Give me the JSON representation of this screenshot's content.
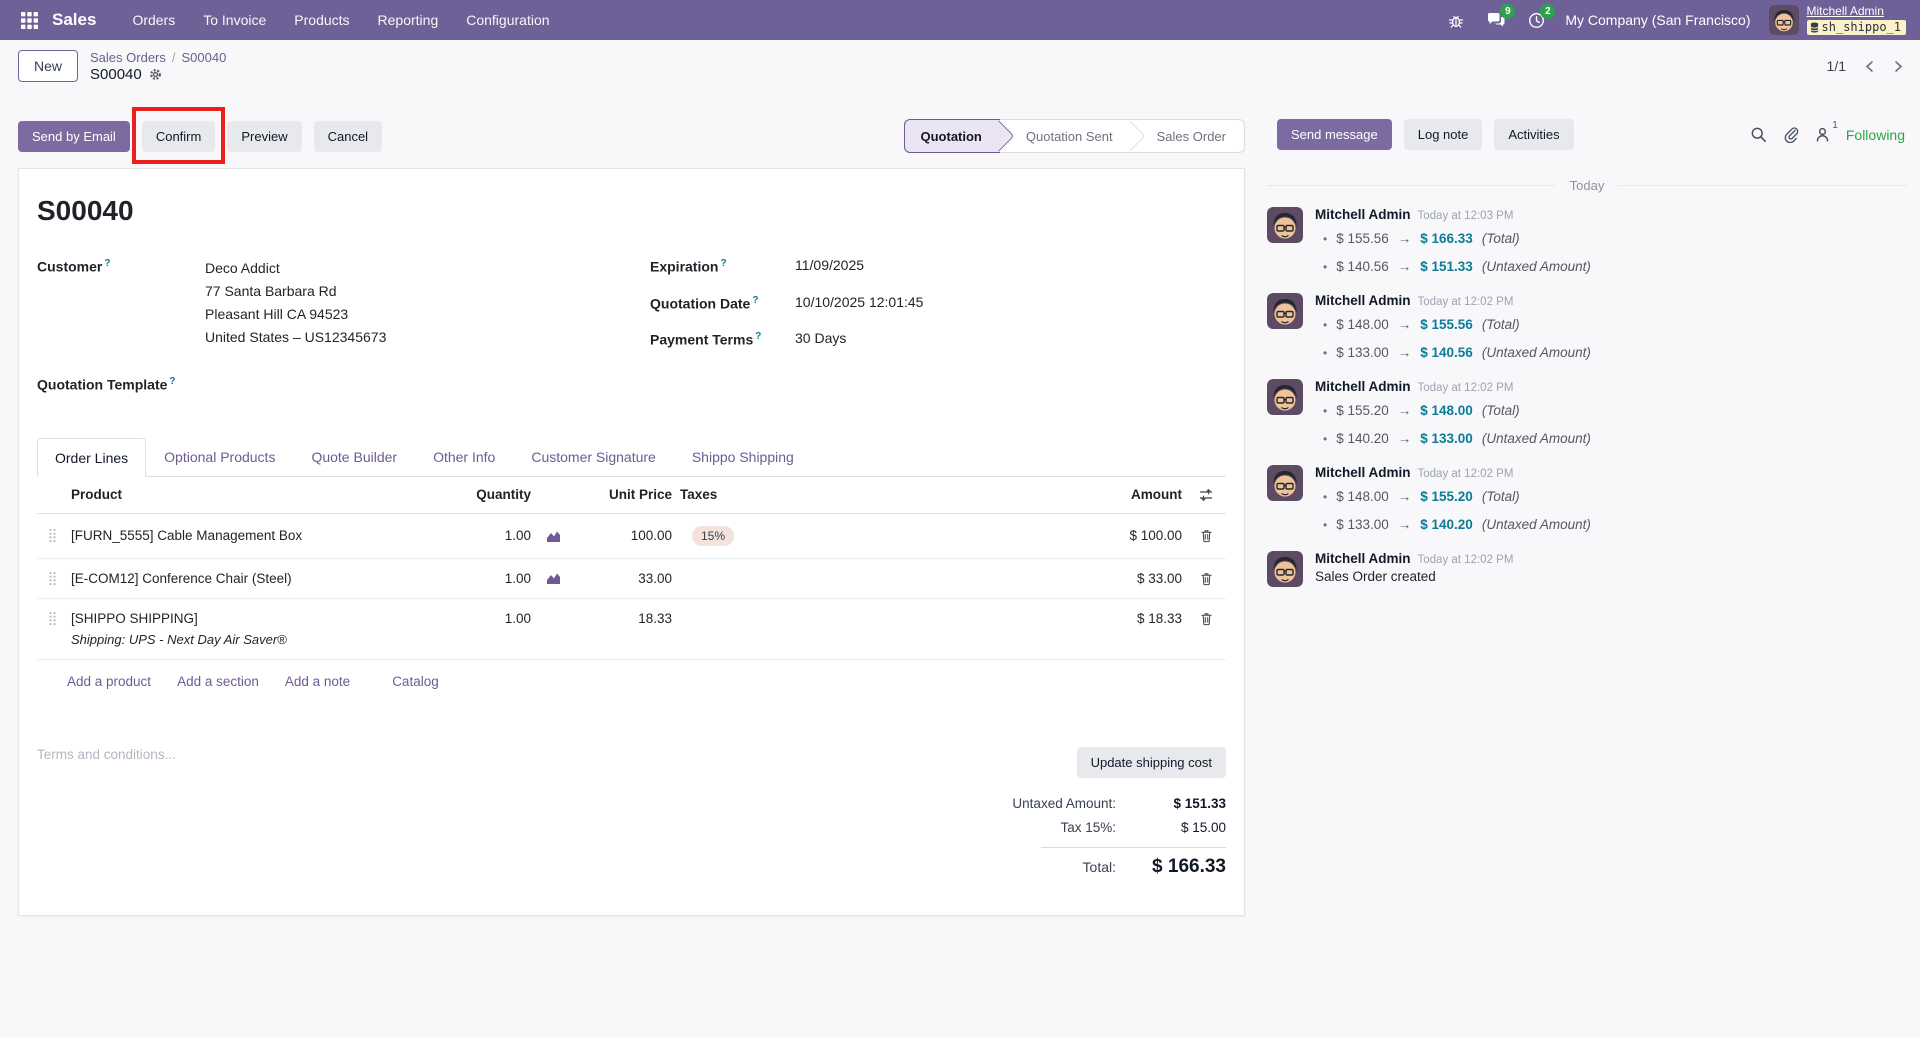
{
  "topbar": {
    "app_name": "Sales",
    "menus": [
      "Orders",
      "To Invoice",
      "Products",
      "Reporting",
      "Configuration"
    ],
    "messages_badge": "9",
    "activities_badge": "2",
    "company": "My Company (San Francisco)",
    "user_name": "Mitchell Admin",
    "database": "sh_shippo_1"
  },
  "control_panel": {
    "new_button": "New",
    "breadcrumb_parent": "Sales Orders",
    "breadcrumb_sep": "/",
    "breadcrumb_current": "S00040",
    "record_name": "S00040",
    "pager": "1/1"
  },
  "actions": {
    "send_by_email": "Send by Email",
    "confirm": "Confirm",
    "preview": "Preview",
    "cancel": "Cancel"
  },
  "statusbar": {
    "steps": [
      "Quotation",
      "Quotation Sent",
      "Sales Order"
    ]
  },
  "form": {
    "title": "S00040",
    "help_marker": "?",
    "customer_label": "Customer",
    "customer_name": "Deco Addict",
    "address_line1": "77 Santa Barbara Rd",
    "address_line2": "Pleasant Hill CA 94523",
    "address_line3": "United States – US12345673",
    "quotation_template_label": "Quotation Template",
    "expiration_label": "Expiration",
    "expiration": "11/09/2025",
    "quotation_date_label": "Quotation Date",
    "quotation_date": "10/10/2025 12:01:45",
    "payment_terms_label": "Payment Terms",
    "payment_terms": "30 Days",
    "tabs": [
      "Order Lines",
      "Optional Products",
      "Quote Builder",
      "Other Info",
      "Customer Signature",
      "Shippo Shipping"
    ],
    "table": {
      "headers": {
        "product": "Product",
        "quantity": "Quantity",
        "unit_price": "Unit Price",
        "taxes": "Taxes",
        "amount": "Amount"
      },
      "rows": [
        {
          "product": "[FURN_5555] Cable Management Box",
          "quantity": "1.00",
          "unit_price": "100.00",
          "tax": "15%",
          "amount": "$ 100.00"
        },
        {
          "product": "[E-COM12] Conference Chair (Steel)",
          "quantity": "1.00",
          "unit_price": "33.00",
          "tax": "",
          "amount": "$ 33.00"
        },
        {
          "product": "[SHIPPO SHIPPING]",
          "note": "Shipping: UPS - Next Day Air Saver®",
          "quantity": "1.00",
          "unit_price": "18.33",
          "tax": "",
          "amount": "$ 18.33"
        }
      ],
      "links": {
        "add_product": "Add a product",
        "add_section": "Add a section",
        "add_note": "Add a note",
        "catalog": "Catalog"
      }
    },
    "terms_placeholder": "Terms and conditions...",
    "update_shipping": "Update shipping cost",
    "totals": {
      "untaxed_label": "Untaxed Amount:",
      "untaxed_value": "$ 151.33",
      "tax_label": "Tax 15%:",
      "tax_value": "$ 15.00",
      "total_label": "Total:",
      "total_value": "$ 166.33"
    }
  },
  "chatter": {
    "send_message": "Send message",
    "log_note": "Log note",
    "activities": "Activities",
    "followers_count": "1",
    "following": "Following",
    "day_divider": "Today",
    "bullet": "•",
    "arrow": "→",
    "messages": [
      {
        "author": "Mitchell Admin",
        "time": "Today at 12:03 PM",
        "changes": [
          {
            "old": "$ 155.56",
            "new": "$ 166.33",
            "field": "(Total)"
          },
          {
            "old": "$ 140.56",
            "new": "$ 151.33",
            "field": "(Untaxed Amount)"
          }
        ]
      },
      {
        "author": "Mitchell Admin",
        "time": "Today at 12:02 PM",
        "changes": [
          {
            "old": "$ 148.00",
            "new": "$ 155.56",
            "field": "(Total)"
          },
          {
            "old": "$ 133.00",
            "new": "$ 140.56",
            "field": "(Untaxed Amount)"
          }
        ]
      },
      {
        "author": "Mitchell Admin",
        "time": "Today at 12:02 PM",
        "changes": [
          {
            "old": "$ 155.20",
            "new": "$ 148.00",
            "field": "(Total)"
          },
          {
            "old": "$ 140.20",
            "new": "$ 133.00",
            "field": "(Untaxed Amount)"
          }
        ]
      },
      {
        "author": "Mitchell Admin",
        "time": "Today at 12:02 PM",
        "changes": [
          {
            "old": "$ 148.00",
            "new": "$ 155.20",
            "field": "(Total)"
          },
          {
            "old": "$ 133.00",
            "new": "$ 140.20",
            "field": "(Untaxed Amount)"
          }
        ]
      },
      {
        "author": "Mitchell Admin",
        "time": "Today at 12:02 PM",
        "body": "Sales Order created"
      }
    ]
  }
}
